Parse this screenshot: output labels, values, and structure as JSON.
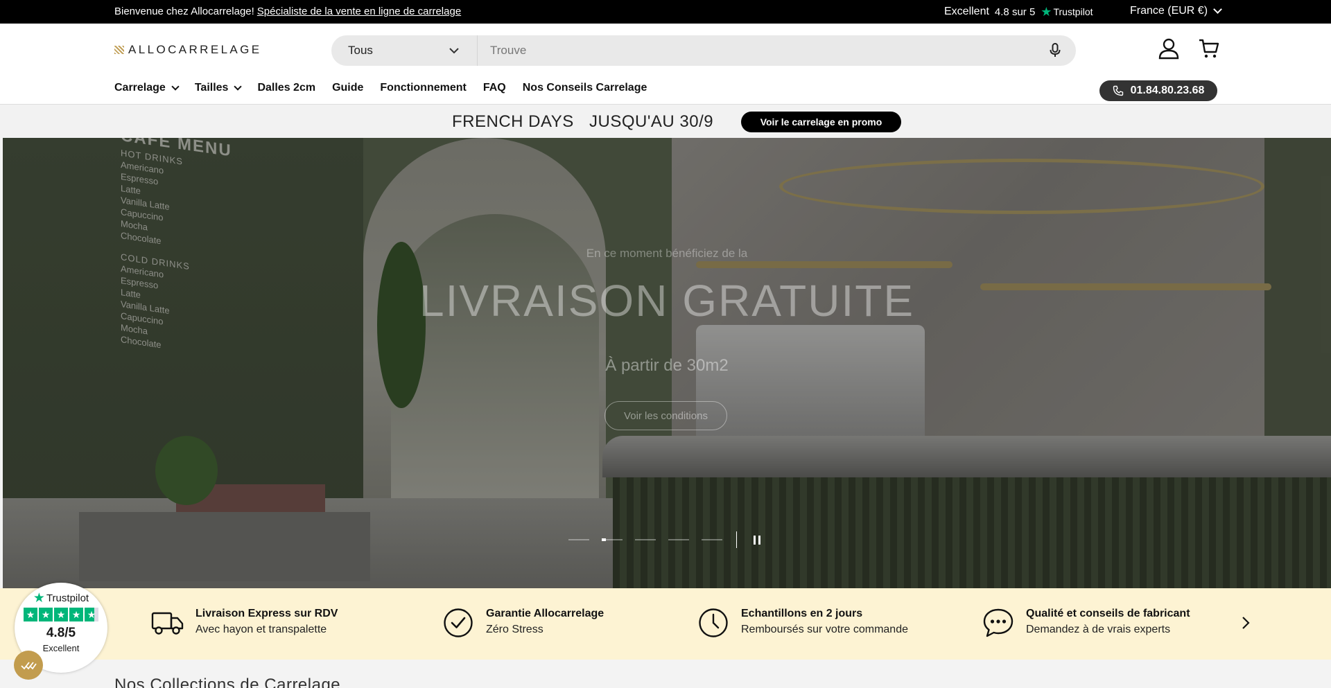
{
  "topbar": {
    "welcome_text": "Bienvenue chez Allocarrelage!",
    "welcome_link": "Spécialiste de la vente en ligne de carrelage",
    "trust_label": "Excellent",
    "trust_score": "4.8 sur 5",
    "trust_brand": "Trustpilot",
    "currency": "France (EUR €)"
  },
  "header": {
    "logo_text": "ALLOCARRELAGE",
    "search_category": "Tous",
    "search_placeholder": "Trouve",
    "nav": [
      "Carrelage",
      "Tailles",
      "Dalles 2cm",
      "Guide",
      "Fonctionnement",
      "FAQ",
      "Nos Conseils Carrelage"
    ],
    "phone": "01.84.80.23.68"
  },
  "promo": {
    "event": "FRENCH DAYS",
    "until": "JUSQU'AU 30/9",
    "button": "Voir le carrelage en promo"
  },
  "hero": {
    "kicker": "En ce moment bénéficiez de la",
    "headline": "LIVRAISON GRATUITE",
    "subtitle": "À partir de 30m2",
    "cta": "Voir les conditions",
    "slide_count": 5,
    "active_slide": 2,
    "menu_board": {
      "title": "CAFE MENU",
      "hot_heading": "HOT DRINKS",
      "cold_heading": "COLD DRINKS",
      "items": [
        "Americano",
        "Espresso",
        "Latte",
        "Vanilla Latte",
        "Capuccino",
        "Mocha",
        "Chocolate"
      ]
    }
  },
  "features": [
    {
      "icon": "truck-icon",
      "title": "Livraison Express sur RDV",
      "desc": "Avec hayon et transpalette"
    },
    {
      "icon": "check-circle-icon",
      "title": "Garantie Allocarrelage",
      "desc": "Zéro Stress"
    },
    {
      "icon": "clock-icon",
      "title": "Echantillons en 2 jours",
      "desc": "Remboursés sur votre commande"
    },
    {
      "icon": "chat-bubble-icon",
      "title": "Qualité et conseils de fabricant",
      "desc": "Demandez à de vrais experts"
    }
  ],
  "trust_widget": {
    "brand": "Trustpilot",
    "rating": "4.8/5",
    "label": "Excellent"
  },
  "collections_title": "Nos Collections de Carrelage",
  "colors": {
    "topbar_bg": "#000000",
    "trustpilot_green": "#00b67a",
    "features_bg": "#fdf3d3",
    "badge_gold": "#c29c4e"
  }
}
